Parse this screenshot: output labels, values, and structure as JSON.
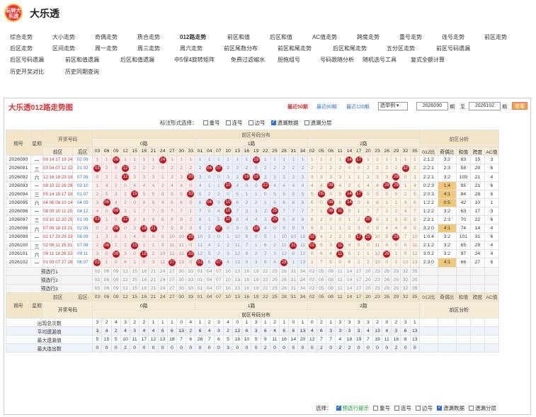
{
  "header": {
    "logo": "玩转大乐透",
    "title": "大乐透"
  },
  "nav": [
    [
      "综合走势",
      "大小走势",
      "奇偶走势",
      "质合走势",
      "012路走势",
      "前区和值",
      "后区和值",
      "AC值走势",
      "跨度走势",
      "重号走势",
      "连号走势",
      "前区走势"
    ],
    [
      "后区走势",
      "区间走势",
      "周一走势",
      "周三走势",
      "周六走势",
      "前区尾数分布",
      "前区和尾走势",
      "后区和尾走势",
      "五分区走势",
      "前区号码遗漏"
    ],
    [
      "后区号码遗漏",
      "前区和值遗漏",
      "后区和值遗漏",
      "中5保4旋转矩阵",
      "免费过滤缩水",
      "胆拖组号",
      "号码跟随分析",
      "随机选号工具",
      "复式全额计算"
    ],
    [
      "历史开奖对比",
      "历史同期查询"
    ]
  ],
  "panel": {
    "title": "大乐透012路走势图",
    "r50": "最近50期",
    "r80": "最近80期",
    "r120": "最近120期",
    "select": "选举例",
    "from": "2026090",
    "to": "2026102",
    "period": "期",
    "to_label": "至",
    "btn": "查看",
    "opt_label": "标注形式选择：",
    "opts": [
      "重号",
      "连号",
      "边号",
      "遗漏数据",
      "遗漏分层"
    ],
    "opts_on": [
      false,
      false,
      false,
      true,
      false
    ]
  },
  "cols": {
    "qihao": "期号",
    "xq": "星期",
    "kjhm": "开奖号码",
    "qq": "前区",
    "hq": "后区",
    "fenbu": "前区号码分布",
    "r0": "0路",
    "r1": "1路",
    "r2": "2路",
    "fx": "前区分析",
    "n0": [
      "03",
      "06",
      "09",
      "12",
      "15",
      "18",
      "21",
      "24",
      "27",
      "30",
      "33"
    ],
    "n1": [
      "01",
      "04",
      "07",
      "10",
      "13",
      "16",
      "19",
      "22",
      "25",
      "28",
      "31",
      "34"
    ],
    "n2": [
      "02",
      "05",
      "08",
      "11",
      "14",
      "17",
      "20",
      "23",
      "26",
      "29",
      "32",
      "35"
    ],
    "fxh": [
      "012比",
      "奇偶比",
      "和值",
      "跨度",
      "AC值"
    ]
  },
  "rows": [
    {
      "q": "2026090",
      "x": "一",
      "f": "09 14 17 19 24",
      "b": "02 09",
      "fx": [
        "2:1:2",
        "3:2",
        "83",
        "15",
        "3"
      ]
    },
    {
      "q": "2026091",
      "x": "三",
      "f": "03 04 07 12 32",
      "b": "01 02",
      "fx": [
        "2:2:1",
        "2:3",
        "58",
        "29",
        "6"
      ]
    },
    {
      "q": "2026092",
      "x": "六",
      "f": "12 16 19 29 33",
      "b": "07 09",
      "fx": [
        "2:2:1",
        "3:2",
        "109",
        "21",
        "4"
      ]
    },
    {
      "q": "2026093",
      "x": "一",
      "f": "08 10 22 26 29",
      "b": "03 10",
      "fx": [
        "0:2:3",
        "1:4",
        "95",
        "21",
        "6"
      ]
    },
    {
      "q": "2026094",
      "x": "三",
      "f": "05 14 15 17 33",
      "b": "01 07",
      "fx": [
        "2:0:3",
        "4:1",
        "84",
        "28",
        "6"
      ]
    },
    {
      "q": "2026095",
      "x": "六",
      "f": "04 06 08 10 14",
      "b": "04 05",
      "fx": [
        "1:2:2",
        "0:5",
        "42",
        "10",
        "1"
      ]
    },
    {
      "q": "2026096",
      "x": "一",
      "f": "08 09 10 11 25",
      "b": "04 12",
      "fx": [
        "1:2:2",
        "3:2",
        "63",
        "17",
        "3"
      ]
    },
    {
      "q": "2026097",
      "x": "三",
      "f": "03 10 12 20 25",
      "b": "01 09",
      "fx": [
        "2:2:1",
        "2:3",
        "70",
        "22",
        "6"
      ]
    },
    {
      "q": "2026098",
      "x": "六",
      "f": "07 09 18 19 21",
      "b": "02 09",
      "fx": [
        "3:2:0",
        "4:1",
        "74",
        "14",
        "4"
      ]
    },
    {
      "q": "2026099",
      "x": "一",
      "f": "02 17 20 29 33",
      "b": "08 09",
      "fx": [
        "1:0:4",
        "3:2",
        "101",
        "31",
        "6"
      ]
    },
    {
      "q": "2026100",
      "x": "三",
      "f": "02 06 11 15 31",
      "b": "07 08",
      "fx": [
        "2:1:2",
        "3:2",
        "65",
        "29",
        "4"
      ]
    },
    {
      "q": "2026101",
      "x": "六",
      "f": "09 11 18 26 33",
      "b": "09 11",
      "fx": [
        "3:0:2",
        "3:2",
        "97",
        "24",
        "4"
      ]
    },
    {
      "q": "2026102",
      "x": "一",
      "f": "01 03 07 27 28",
      "b": "06 07",
      "fx": [
        "2:3:0",
        "4:1",
        "66",
        "27",
        "6"
      ]
    }
  ],
  "predict": [
    "预选行1",
    "预选行2",
    "预选行3"
  ],
  "stats": [
    {
      "n": "出现总次数",
      "v": [
        "3",
        "2",
        "4",
        "3",
        "2",
        "2",
        "1",
        "1",
        "1",
        "0",
        "4",
        "1",
        "2",
        "3",
        "4",
        "0",
        "1",
        "3",
        "1",
        "2",
        "1",
        "0",
        "1",
        "0",
        "2",
        "1",
        "3",
        "3",
        "3",
        "3",
        "2",
        "0",
        "2",
        "3",
        "1",
        "0"
      ]
    },
    {
      "n": "平均遗漏值",
      "v": [
        "3",
        "4",
        "2",
        "4",
        "3",
        "4",
        "4",
        "6",
        "6",
        "13",
        "2",
        "6",
        "4",
        "3",
        "2",
        "13",
        "6",
        "3",
        "6",
        "4",
        "6",
        "6",
        "13",
        "4",
        "6",
        "3",
        "3",
        "3",
        "3",
        "4",
        "13",
        "4",
        "3",
        "6",
        "13",
        "4"
      ]
    },
    {
      "n": "最大遗漏值",
      "v": [
        "5",
        "15",
        "5",
        "10",
        "11",
        "17",
        "12",
        "13",
        "18",
        "7",
        "6",
        "26",
        "7",
        "6",
        "5",
        "18",
        "10",
        "5",
        "9",
        "11",
        "16",
        "14",
        "20",
        "12",
        "7",
        "7",
        "4",
        "18",
        "19",
        "7",
        "19",
        "11",
        "16",
        "8",
        "13",
        "17"
      ]
    },
    {
      "n": "最大连出数",
      "v": [
        "0",
        "0",
        "0",
        "2",
        "0",
        "0",
        "0",
        "0",
        "0",
        "0",
        "0",
        "0",
        "0",
        "0",
        "3",
        "0",
        "0",
        "0",
        "2",
        "0",
        "0",
        "0",
        "0",
        "0",
        "2",
        "0",
        "2",
        "2",
        "0",
        "0",
        "0",
        "0",
        "2",
        "0",
        "0",
        "0"
      ]
    }
  ],
  "foot": {
    "label": "选择：",
    "opts": [
      "预选行提示",
      "重号",
      "连号",
      "边号",
      "遗漏数据",
      "遗漏分层"
    ],
    "on": [
      true,
      false,
      false,
      false,
      true,
      false
    ]
  }
}
